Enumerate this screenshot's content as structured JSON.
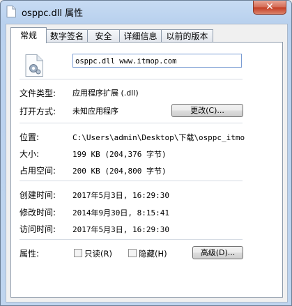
{
  "window": {
    "title": "osppc.dll 属性",
    "close_label": "✕"
  },
  "tabs": [
    "常规",
    "数字签名",
    "安全",
    "详细信息",
    "以前的版本"
  ],
  "general": {
    "file_name": "osppc.dll www.itmop.com",
    "file_type_label": "文件类型:",
    "file_type_value": "应用程序扩展 (.dll)",
    "opens_with_label": "打开方式:",
    "opens_with_value": "未知应用程序",
    "change_button": "更改(C)...",
    "location_label": "位置:",
    "location_value": "C:\\Users\\admin\\Desktop\\下载\\osppc_itmop.c",
    "size_label": "大小:",
    "size_value": "199 KB (204,376 字节)",
    "size_on_disk_label": "占用空间:",
    "size_on_disk_value": "200 KB (204,800 字节)",
    "created_label": "创建时间:",
    "created_value": "2017年5月3日, 16:29:30",
    "modified_label": "修改时间:",
    "modified_value": "2014年9月30日, 8:15:41",
    "accessed_label": "访问时间:",
    "accessed_value": "2017年5月3日, 16:29:30",
    "attributes_label": "属性:",
    "readonly_label": "只读(R)",
    "hidden_label": "隐藏(H)",
    "advanced_button": "高级(D)..."
  }
}
